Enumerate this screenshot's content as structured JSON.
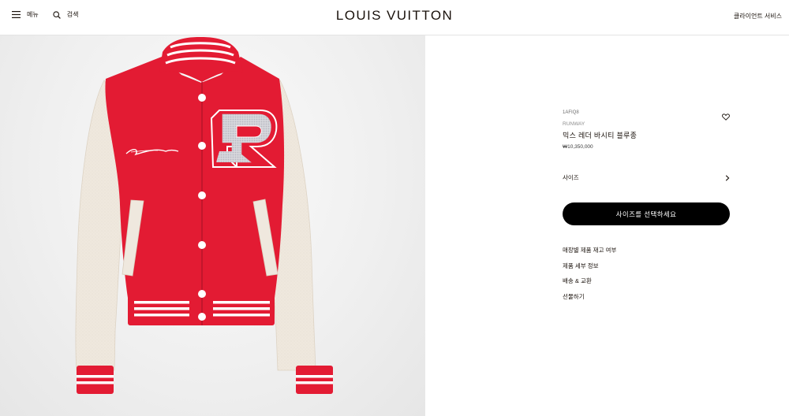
{
  "header": {
    "menu_label": "메뉴",
    "search_label": "검색",
    "brand": "LOUIS VUITTON",
    "client_service": "클라이언트 서비스"
  },
  "product": {
    "sku": "1AFIQ8",
    "collection": "RUNWAY",
    "name": "믹스 레더 바시티 블루종",
    "price": "₩10,350,000",
    "size_label": "사이즈",
    "cta_label": "사이즈를 선택하세요",
    "links": [
      "매장별 제품 재고 여부",
      "제품 세부 정보",
      "배송 & 교환",
      "선물하기"
    ],
    "colors": {
      "body": "#e31b33",
      "sleeve": "#efe8de",
      "stripe": "#ffffff"
    }
  }
}
